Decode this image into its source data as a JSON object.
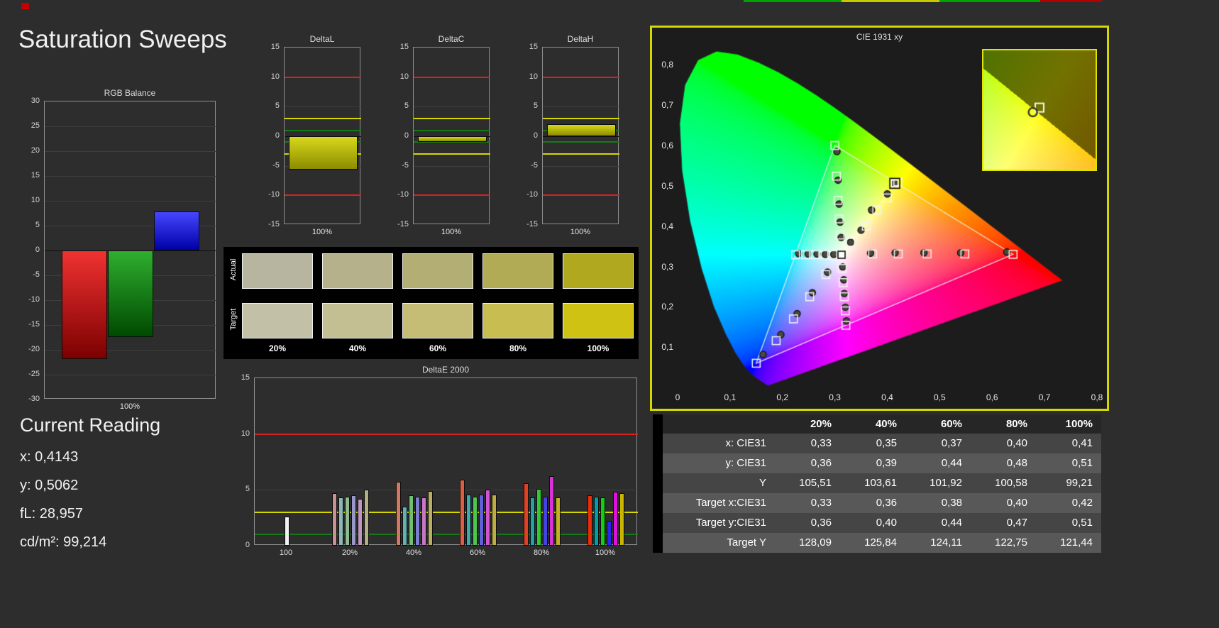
{
  "title": "Saturation Sweeps",
  "current_reading": {
    "heading": "Current Reading",
    "lines": [
      "x: 0,4143",
      "y: 0,5062",
      "fL: 28,957",
      "cd/m²: 99,214"
    ]
  },
  "swatches": {
    "row_labels": [
      "Actual",
      "Target"
    ],
    "col_labels": [
      "20%",
      "40%",
      "60%",
      "80%",
      "100%"
    ],
    "actual": [
      "#b7b49f",
      "#b5b28b",
      "#b3ae74",
      "#b2ab55",
      "#b0a81e"
    ],
    "target": [
      "#c3c0a8",
      "#c3bf92",
      "#c5bd75",
      "#c8bd51",
      "#cfc213"
    ]
  },
  "table": {
    "columns": [
      "20%",
      "40%",
      "60%",
      "80%",
      "100%"
    ],
    "rows": [
      {
        "label": "x: CIE31",
        "values": [
          "0,33",
          "0,35",
          "0,37",
          "0,40",
          "0,41"
        ]
      },
      {
        "label": "y: CIE31",
        "values": [
          "0,36",
          "0,39",
          "0,44",
          "0,48",
          "0,51"
        ]
      },
      {
        "label": "Y",
        "values": [
          "105,51",
          "103,61",
          "101,92",
          "100,58",
          "99,21"
        ]
      },
      {
        "label": "Target x:CIE31",
        "values": [
          "0,33",
          "0,36",
          "0,38",
          "0,40",
          "0,42"
        ]
      },
      {
        "label": "Target y:CIE31",
        "values": [
          "0,36",
          "0,40",
          "0,44",
          "0,47",
          "0,51"
        ]
      },
      {
        "label": "Target Y",
        "values": [
          "128,09",
          "125,84",
          "124,11",
          "122,75",
          "121,44"
        ]
      }
    ]
  },
  "chart_data": {
    "rgb_balance": {
      "type": "bar",
      "title": "RGB Balance",
      "xlabel": "100%",
      "ylim": [
        -30,
        30
      ],
      "yticks": [
        30,
        25,
        20,
        15,
        10,
        5,
        0,
        -5,
        -10,
        -15,
        -20,
        -25,
        -30
      ],
      "series": [
        {
          "name": "Red",
          "value": -21.8,
          "gradient": [
            "#f03232",
            "#7c0000"
          ]
        },
        {
          "name": "Green",
          "value": -17.4,
          "gradient": [
            "#2fae2f",
            "#004a00"
          ]
        },
        {
          "name": "Blue",
          "value": 7.8,
          "gradient": [
            "#4646ff",
            "#0000a6"
          ]
        }
      ]
    },
    "delta_l": {
      "type": "bar",
      "title": "DeltaL",
      "xlabel": "100%",
      "ylim": [
        -15,
        15
      ],
      "yticks": [
        15,
        10,
        5,
        0,
        -5,
        -10,
        -15
      ],
      "limits": {
        "red": 10,
        "yellow": 3,
        "green": 1
      },
      "value": -5.6,
      "gradient": [
        "#d8d81c",
        "#8c8c00"
      ]
    },
    "delta_c": {
      "type": "bar",
      "title": "DeltaC",
      "xlabel": "100%",
      "ylim": [
        -15,
        15
      ],
      "yticks": [
        15,
        10,
        5,
        0,
        -5,
        -10,
        -15
      ],
      "limits": {
        "red": 10,
        "yellow": 3,
        "green": 1
      },
      "value": -0.9,
      "gradient": [
        "#d8d81c",
        "#8c8c00"
      ]
    },
    "delta_h": {
      "type": "bar",
      "title": "DeltaH",
      "xlabel": "100%",
      "ylim": [
        -15,
        15
      ],
      "yticks": [
        15,
        10,
        5,
        0,
        -5,
        -10,
        -15
      ],
      "limits": {
        "red": 10,
        "yellow": 3,
        "green": 1
      },
      "value": 2.1,
      "gradient": [
        "#d8d81c",
        "#8c8c00"
      ]
    },
    "delta_e": {
      "type": "grouped-bar",
      "title": "DeltaE 2000",
      "ylim": [
        0,
        15
      ],
      "yticks": [
        15,
        10,
        5,
        0
      ],
      "limits": {
        "red": 10,
        "yellow": 3,
        "green": 1
      },
      "groups": [
        {
          "label": "100",
          "bars": [
            {
              "color": "#f2f2f2",
              "value": 2.6
            }
          ]
        },
        {
          "label": "20%",
          "bars": [
            {
              "color": "#c79292",
              "value": 4.7
            },
            {
              "color": "#8db6b6",
              "value": 4.3
            },
            {
              "color": "#90ba90",
              "value": 4.4
            },
            {
              "color": "#9898c8",
              "value": 4.5
            },
            {
              "color": "#c094c0",
              "value": 4.2
            },
            {
              "color": "#b4ae86",
              "value": 5.0
            }
          ]
        },
        {
          "label": "40%",
          "bars": [
            {
              "color": "#d07a64",
              "value": 5.7
            },
            {
              "color": "#62b2b2",
              "value": 3.5
            },
            {
              "color": "#70c070",
              "value": 4.5
            },
            {
              "color": "#7c7cd2",
              "value": 4.4
            },
            {
              "color": "#c876c8",
              "value": 4.3
            },
            {
              "color": "#b8ae62",
              "value": 4.9
            }
          ]
        },
        {
          "label": "60%",
          "bars": [
            {
              "color": "#d95e42",
              "value": 5.9
            },
            {
              "color": "#3daaaa",
              "value": 4.6
            },
            {
              "color": "#4ec64e",
              "value": 4.4
            },
            {
              "color": "#6060da",
              "value": 4.6
            },
            {
              "color": "#d054d0",
              "value": 5.0
            },
            {
              "color": "#beae42",
              "value": 4.6
            }
          ]
        },
        {
          "label": "80%",
          "bars": [
            {
              "color": "#e04122",
              "value": 5.6
            },
            {
              "color": "#20a4a4",
              "value": 4.3
            },
            {
              "color": "#2eca2e",
              "value": 5.1
            },
            {
              "color": "#4444e4",
              "value": 4.4
            },
            {
              "color": "#d832d8",
              "value": 6.2
            },
            {
              "color": "#c4b022",
              "value": 4.3
            }
          ]
        },
        {
          "label": "100%",
          "bars": [
            {
              "color": "#e82d0a",
              "value": 4.5
            },
            {
              "color": "#00a0a0",
              "value": 4.4
            },
            {
              "color": "#14cd14",
              "value": 4.3
            },
            {
              "color": "#2828ec",
              "value": 2.2
            },
            {
              "color": "#de10de",
              "value": 4.8
            },
            {
              "color": "#cab400",
              "value": 4.7
            }
          ]
        }
      ]
    },
    "cie": {
      "type": "scatter",
      "title": "CIE 1931 xy",
      "xlim": [
        0,
        0.8
      ],
      "ylim": [
        0,
        0.85
      ],
      "xticks": [
        "0",
        "0,1",
        "0,2",
        "0,3",
        "0,4",
        "0,5",
        "0,6",
        "0,7",
        "0,8"
      ],
      "yticks": [
        "0,1",
        "0,2",
        "0,3",
        "0,4",
        "0,5",
        "0,6",
        "0,7",
        "0,8"
      ],
      "gamut_triangle": [
        [
          0.64,
          0.33
        ],
        [
          0.3,
          0.6
        ],
        [
          0.15,
          0.06
        ]
      ],
      "white_point": [
        0.3127,
        0.329
      ],
      "selected": [
        0.4143,
        0.5062
      ],
      "inset": {
        "xlim": [
          0.372,
          0.468
        ],
        "ylim": [
          0.458,
          0.558
        ]
      },
      "sweeps": {
        "red": {
          "targets": [
            [
              0.372,
              0.331
            ],
            [
              0.421,
              0.331
            ],
            [
              0.476,
              0.331
            ],
            [
              0.548,
              0.331
            ],
            [
              0.64,
              0.33
            ]
          ],
          "measured": [
            [
              0.368,
              0.333
            ],
            [
              0.415,
              0.334
            ],
            [
              0.47,
              0.334
            ],
            [
              0.54,
              0.334
            ],
            [
              0.628,
              0.336
            ]
          ]
        },
        "green": {
          "targets": [
            [
              0.31,
              0.378
            ],
            [
              0.308,
              0.418
            ],
            [
              0.306,
              0.464
            ],
            [
              0.303,
              0.524
            ],
            [
              0.3,
              0.6
            ]
          ],
          "measured": [
            [
              0.312,
              0.372
            ],
            [
              0.31,
              0.41
            ],
            [
              0.308,
              0.455
            ],
            [
              0.306,
              0.514
            ],
            [
              0.304,
              0.585
            ]
          ]
        },
        "blue": {
          "targets": [
            [
              0.283,
              0.28
            ],
            [
              0.252,
              0.225
            ],
            [
              0.221,
              0.17
            ],
            [
              0.188,
              0.116
            ],
            [
              0.15,
              0.06
            ]
          ],
          "measured": [
            [
              0.286,
              0.286
            ],
            [
              0.257,
              0.235
            ],
            [
              0.228,
              0.183
            ],
            [
              0.197,
              0.131
            ],
            [
              0.163,
              0.082
            ]
          ]
        },
        "cyan": {
          "targets": [
            [
              0.296,
              0.329
            ],
            [
              0.279,
              0.329
            ],
            [
              0.262,
              0.329
            ],
            [
              0.244,
              0.329
            ],
            [
              0.225,
              0.329
            ]
          ],
          "measured": [
            [
              0.298,
              0.33
            ],
            [
              0.282,
              0.33
            ],
            [
              0.266,
              0.331
            ],
            [
              0.249,
              0.331
            ],
            [
              0.231,
              0.332
            ]
          ]
        },
        "magenta": {
          "targets": [
            [
              0.314,
              0.295
            ],
            [
              0.316,
              0.26
            ],
            [
              0.318,
              0.225
            ],
            [
              0.32,
              0.19
            ],
            [
              0.321,
              0.154
            ]
          ],
          "measured": [
            [
              0.315,
              0.299
            ],
            [
              0.317,
              0.267
            ],
            [
              0.318,
              0.233
            ],
            [
              0.32,
              0.199
            ],
            [
              0.322,
              0.165
            ]
          ]
        },
        "yellow": {
          "targets": [
            [
              0.33,
              0.36
            ],
            [
              0.36,
              0.4
            ],
            [
              0.38,
              0.44
            ],
            [
              0.4,
              0.47
            ],
            [
              0.42,
              0.51
            ]
          ],
          "measured": [
            [
              0.33,
              0.36
            ],
            [
              0.35,
              0.39
            ],
            [
              0.37,
              0.44
            ],
            [
              0.4,
              0.48
            ],
            [
              0.4143,
              0.5062
            ]
          ]
        }
      }
    }
  },
  "decor": {
    "top_left_square": "#c40000",
    "top_strip": [
      {
        "from": 1048,
        "to": 1186,
        "color": "#00a400"
      },
      {
        "from": 1186,
        "to": 1324,
        "color": "#c8c800"
      },
      {
        "from": 1324,
        "to": 1466,
        "color": "#00a400"
      },
      {
        "from": 1466,
        "to": 1553,
        "color": "#b40000"
      }
    ]
  }
}
